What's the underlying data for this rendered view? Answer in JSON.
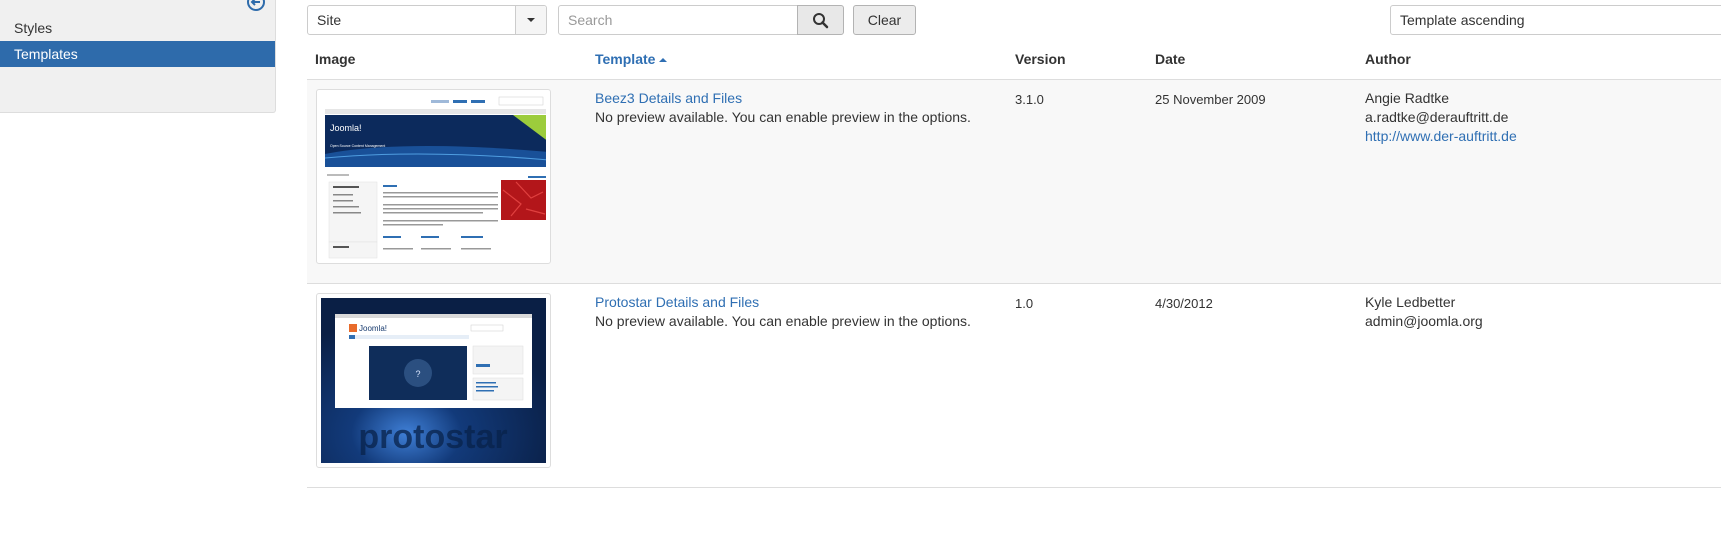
{
  "sidebar": {
    "items": [
      {
        "label": "Styles",
        "active": false
      },
      {
        "label": "Templates",
        "active": true
      }
    ]
  },
  "filters": {
    "client_value": "Site",
    "search_placeholder": "Search",
    "clear_label": "Clear",
    "sort_value": "Template ascending"
  },
  "table": {
    "headers": {
      "image": "Image",
      "template": "Template",
      "version": "Version",
      "date": "Date",
      "author": "Author"
    },
    "rows": [
      {
        "name": "Beez3 Details and Files",
        "note": "No preview available. You can enable preview in the options.",
        "version": "3.1.0",
        "date": "25 November 2009",
        "author": "Angie Radtke",
        "email": "a.radtke@derauftritt.de",
        "url": "http://www.der-auftritt.de",
        "thumb": {
          "logo": "Joomla!",
          "tagline": "Open Source Content Management"
        }
      },
      {
        "name": "Protostar Details and Files",
        "note": "No preview available. You can enable preview in the options.",
        "version": "1.0",
        "date": "4/30/2012",
        "author": "Kyle Ledbetter",
        "email": "admin@joomla.org",
        "url": "",
        "thumb": {
          "logo": "Joomla!",
          "wordmark": "protostar"
        }
      }
    ]
  },
  "colors": {
    "accent": "#2e6bab",
    "link": "#2f6fb3"
  }
}
